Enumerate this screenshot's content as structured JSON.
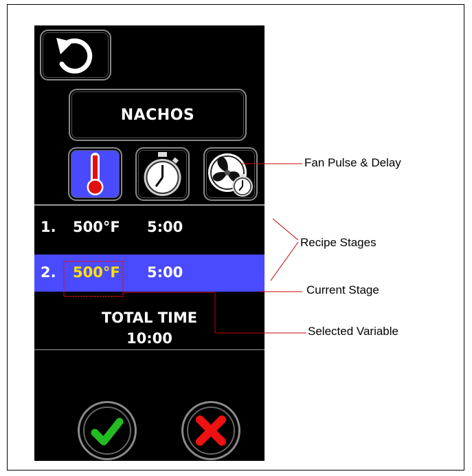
{
  "recipe": {
    "name": "NACHOS"
  },
  "icons": {
    "back": "undo-arrow-icon",
    "temperature": "thermometer-icon",
    "timer": "stopwatch-icon",
    "fan": "fan-timer-icon",
    "confirm": "check-mark-icon",
    "cancel": "x-mark-icon"
  },
  "stages": [
    {
      "number": "1.",
      "temperature": "500°F",
      "time": "5:00",
      "current": false
    },
    {
      "number": "2.",
      "temperature": "500°F",
      "time": "5:00",
      "current": true
    }
  ],
  "total": {
    "label": "TOTAL TIME",
    "value": "10:00"
  },
  "annotations": {
    "fan": "Fan Pulse & Delay",
    "stages": "Recipe Stages",
    "current": "Current Stage",
    "selected": "Selected Variable"
  },
  "colors": {
    "screen_bg": "#000000",
    "selected_tab": "#4a4aff",
    "current_stage_bg": "#4a4aff",
    "selected_value_text": "#ffe300",
    "annotation_line": "#cc0000",
    "confirm_green": "#22bb22",
    "cancel_red": "#ee1111"
  }
}
